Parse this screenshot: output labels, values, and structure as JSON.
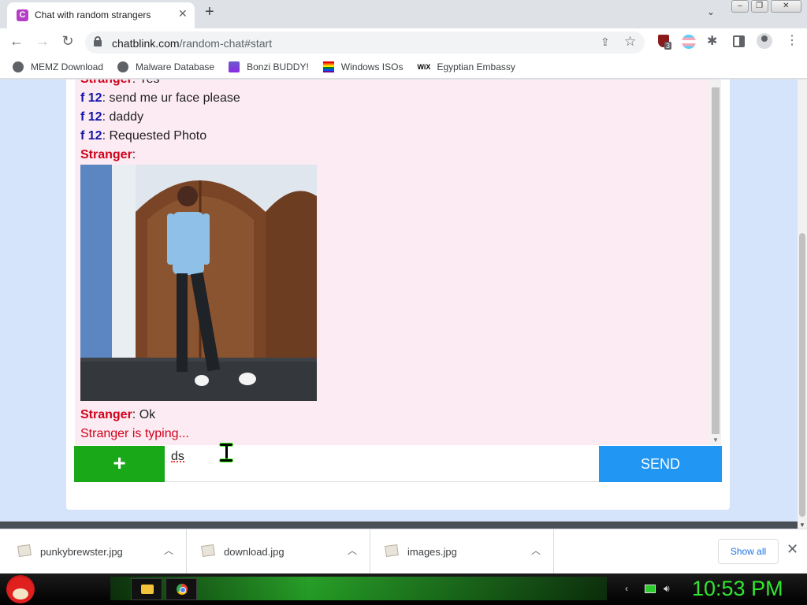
{
  "browser": {
    "tab_title": "Chat with random strangers",
    "tab_favicon_letter": "C",
    "url_host": "chatblink.com",
    "url_path": "/random-chat#start",
    "extension_badge": "3"
  },
  "bookmarks": [
    {
      "label": "MEMZ Download",
      "icon": "globe-icon"
    },
    {
      "label": "Malware Database",
      "icon": "globe-icon"
    },
    {
      "label": "Bonzi BUDDY!",
      "icon": "bonzi-icon"
    },
    {
      "label": "Windows ISOs",
      "icon": "rainbow-flag-icon"
    },
    {
      "label": "Egyptian Embassy",
      "icon": "wix-icon"
    }
  ],
  "chat": {
    "messages": [
      {
        "sender": "Stranger",
        "text": "Yes"
      },
      {
        "sender": "f 12",
        "text": "send me ur face please"
      },
      {
        "sender": "f 12",
        "text": "daddy"
      },
      {
        "sender": "f 12",
        "text": "Requested Photo"
      },
      {
        "sender": "Stranger",
        "text": ""
      },
      {
        "sender": "Stranger",
        "text": "Ok"
      }
    ],
    "separator": ": ",
    "typing_text": "Stranger is typing...",
    "input_value": "ds",
    "add_label": "+",
    "send_label": "SEND"
  },
  "downloads": {
    "items": [
      "punkybrewster.jpg",
      "download.jpg",
      "images.jpg"
    ],
    "show_all_label": "Show all"
  },
  "taskbar": {
    "clock": "10:53 PM"
  },
  "colors": {
    "send_button": "#2196f3",
    "add_button": "#18a818",
    "stranger_name": "#d0021b",
    "you_name": "#1515a8",
    "clock": "#32e632"
  }
}
